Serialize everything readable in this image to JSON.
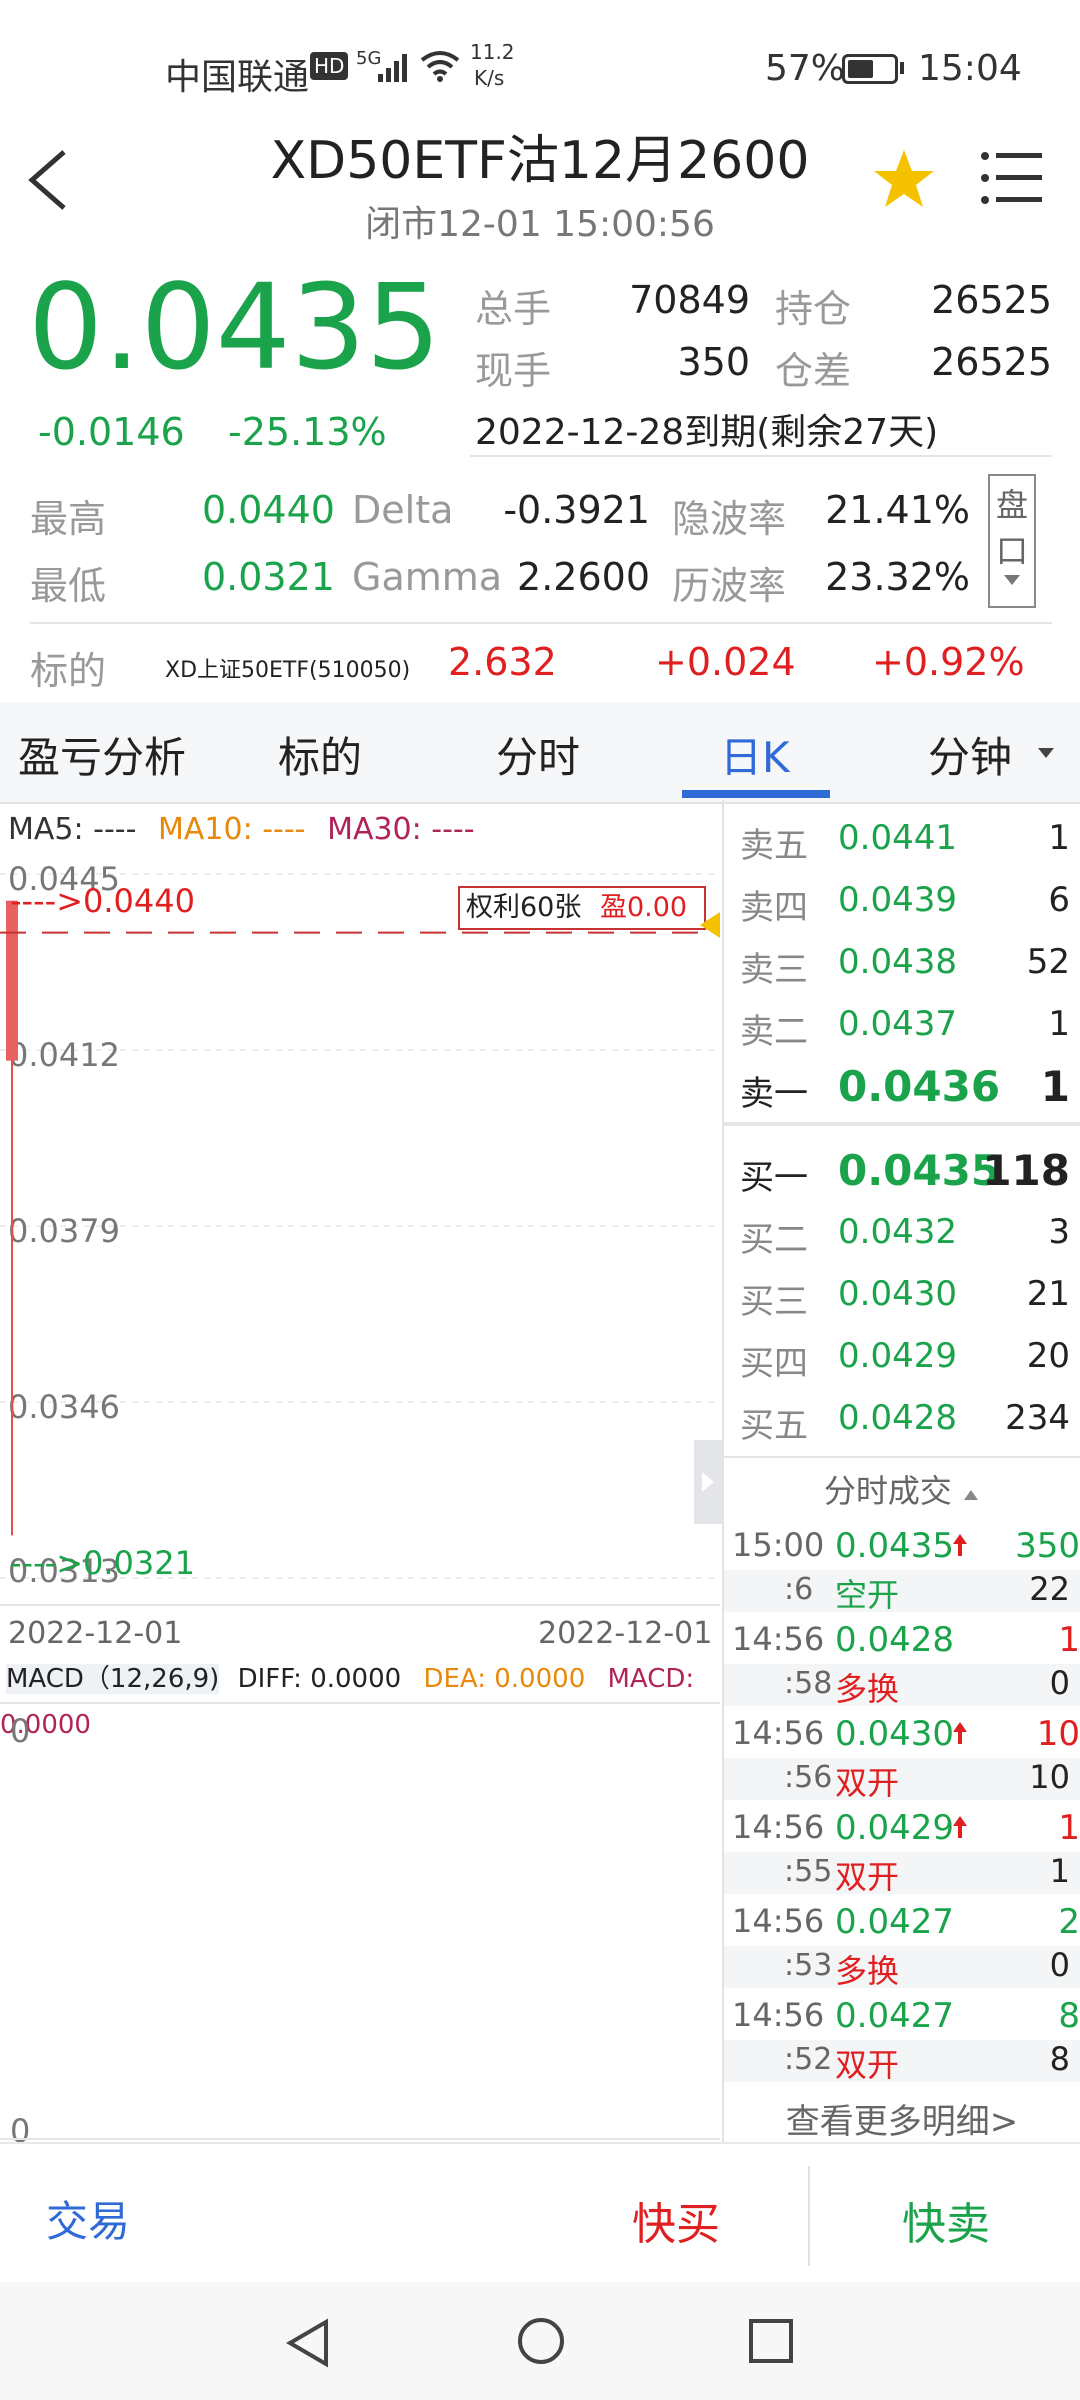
{
  "status_bar": {
    "carrier": "中国联通",
    "hd": "HD",
    "net": "5G",
    "speed_value": "11.2",
    "speed_unit": "K/s",
    "battery": "57%",
    "battery_level": 0.57,
    "time": "15:04"
  },
  "header": {
    "title": "XD50ETF沽12月2600",
    "subtitle": "闭市12-01  15:00:56"
  },
  "quote": {
    "price": "0.0435",
    "change": "-0.0146",
    "change_pct": "-25.13%",
    "total_volume_label": "总手",
    "total_volume": "70849",
    "open_interest_label": "持仓",
    "open_interest": "26525",
    "current_volume_label": "现手",
    "current_volume": "350",
    "oi_change_label": "仓差",
    "oi_change": "26525",
    "expiry": "2022-12-28到期(剩余27天)"
  },
  "stats": {
    "high_label": "最高",
    "high": "0.0440",
    "low_label": "最低",
    "low": "0.0321",
    "delta_label": "Delta",
    "delta": "-0.3921",
    "gamma_label": "Gamma",
    "gamma": "2.2600",
    "iv_label": "隐波率",
    "iv": "21.41%",
    "hv_label": "历波率",
    "hv": "23.32%",
    "pankou_1": "盘",
    "pankou_2": "口"
  },
  "underlying": {
    "label": "标的",
    "name": "XD上证50ETF(510050)",
    "price": "2.632",
    "change": "+0.024",
    "change_pct": "+0.92%"
  },
  "tabs": [
    "盈亏分析",
    "标的",
    "分时",
    "日K",
    "分钟"
  ],
  "chart": {
    "ma5": "MA5: ----",
    "ma10": "MA10: ----",
    "ma30": "MA30: ----",
    "high_marker": "---->0.0440",
    "low_marker": "---->0.0321",
    "position_box_label": "权利60张",
    "position_box_pl": "盈0.00",
    "date_left": "2022-12-01",
    "date_right": "2022-12-01",
    "macd_params": "MACD（12,26,9)",
    "diff": "DIFF: 0.0000",
    "dea": "DEA: 0.0000",
    "macd": "MACD: 0.0000",
    "macd_top": "0",
    "macd_bottom": "0"
  },
  "chart_data": {
    "type": "bar",
    "categories": [
      "2022-12-01"
    ],
    "y_ticks": [
      "0.0445",
      "0.0412",
      "0.0379",
      "0.0346",
      "0.0313"
    ],
    "ylim": [
      0.0313,
      0.0445
    ],
    "candle": {
      "open": 0.044,
      "high": 0.044,
      "low": 0.0321,
      "close": 0.0435
    },
    "line_value": 0.044
  },
  "order_book": {
    "asks": [
      {
        "label": "卖五",
        "price": "0.0441",
        "vol": "1"
      },
      {
        "label": "卖四",
        "price": "0.0439",
        "vol": "6"
      },
      {
        "label": "卖三",
        "price": "0.0438",
        "vol": "52"
      },
      {
        "label": "卖二",
        "price": "0.0437",
        "vol": "1"
      },
      {
        "label": "卖一",
        "price": "0.0436",
        "vol": "1"
      }
    ],
    "bids": [
      {
        "label": "买一",
        "price": "0.0435",
        "vol": "118"
      },
      {
        "label": "买二",
        "price": "0.0432",
        "vol": "3"
      },
      {
        "label": "买三",
        "price": "0.0430",
        "vol": "21"
      },
      {
        "label": "买四",
        "price": "0.0429",
        "vol": "20"
      },
      {
        "label": "买五",
        "price": "0.0428",
        "vol": "234"
      }
    ]
  },
  "trades": {
    "title": "分时成交",
    "rows": [
      {
        "time": "15:00",
        "sec": ":6",
        "price": "0.0435",
        "vol": "350",
        "type": "空开",
        "num": "22"
      },
      {
        "time": "14:56",
        "sec": ":58",
        "price": "0.0428",
        "vol": "1",
        "type": "多换",
        "num": "0"
      },
      {
        "time": "14:56",
        "sec": ":56",
        "price": "0.0430",
        "vol": "10",
        "type": "双开",
        "num": "10"
      },
      {
        "time": "14:56",
        "sec": ":55",
        "price": "0.0429",
        "vol": "1",
        "type": "双开",
        "num": "1"
      },
      {
        "time": "14:56",
        "sec": ":53",
        "price": "0.0427",
        "vol": "2",
        "type": "多换",
        "num": "0"
      },
      {
        "time": "14:56",
        "sec": ":52",
        "price": "0.0427",
        "vol": "8",
        "type": "双开",
        "num": "8"
      }
    ],
    "more": "查看更多明细>"
  },
  "bottom_bar": {
    "trade": "交易",
    "quick_buy": "快买",
    "quick_sell": "快卖"
  }
}
